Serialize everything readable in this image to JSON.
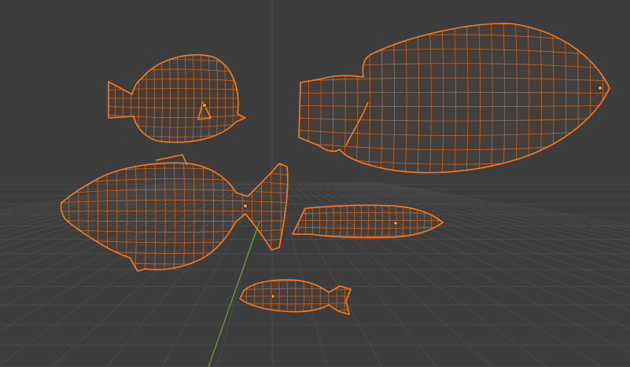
{
  "viewport": {
    "name": "3D Viewport",
    "background_color": "#3d3d3d",
    "grid_color": "#4a4a4a",
    "y_axis_color": "#6ea13b",
    "selection_color": "#ff7a1a",
    "wire_color": "#d9661c"
  },
  "objects": [
    {
      "id": "tang-fish",
      "icon": "fish-mesh-icon",
      "selected": true
    },
    {
      "id": "large-fish",
      "icon": "fish-mesh-icon",
      "selected": true
    },
    {
      "id": "cichlid-fish",
      "icon": "fish-mesh-icon",
      "selected": true
    },
    {
      "id": "slim-fish",
      "icon": "fish-mesh-icon",
      "selected": true
    },
    {
      "id": "small-fish",
      "icon": "fish-mesh-icon",
      "selected": true
    }
  ]
}
